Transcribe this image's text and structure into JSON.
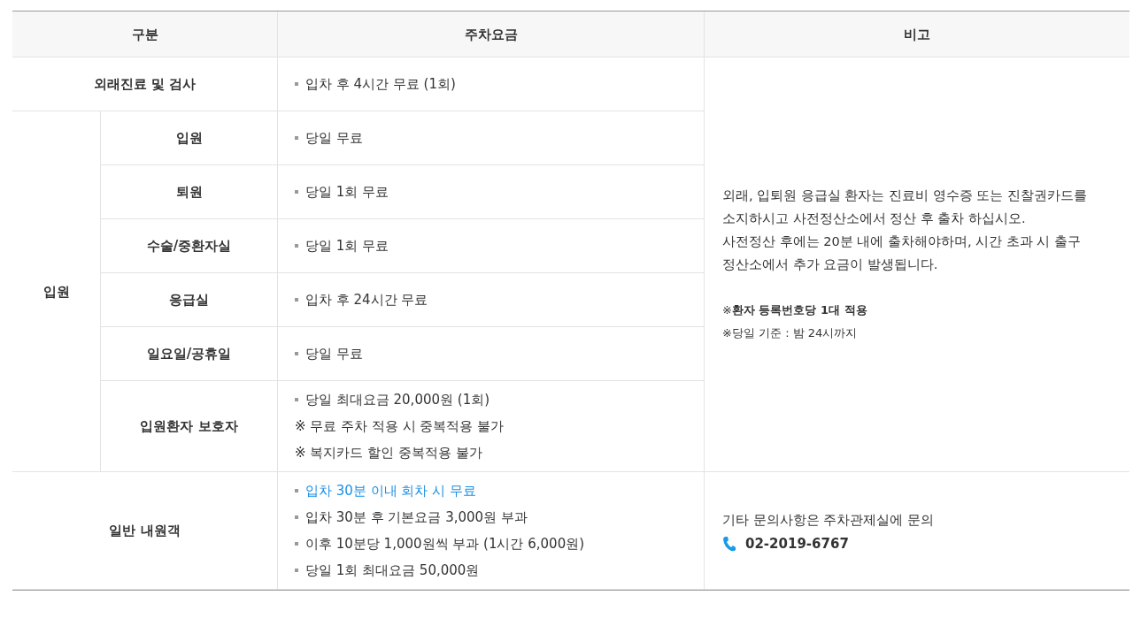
{
  "table": {
    "columns": [
      "구분",
      "주차요금",
      "비고"
    ],
    "sections": [
      {
        "label": "외래진료 및 검사",
        "remark": {
          "paragraphs": [
            "외래, 입퇴원 응급실 환자는 진료비 영수증 또는 진찰권카드를 소지하시고 사전정산소에서 정산 후 출차 하십시오.",
            "사전정산 후에는 20분 내에 출차해야하며, 시간 초과 시 출구 정산소에서 추가 요금이 발생됩니다."
          ],
          "notes": [
            "※**환자 등록번호당 1대 적용**",
            "※당일 기준 : 밤 24시까지"
          ]
        },
        "rows": [
          {
            "fees": [
              {
                "kind": "bullet",
                "text": "입차 후 4시간 무료 (1회)",
                "highlight": false
              }
            ]
          }
        ]
      },
      {
        "label": "입원",
        "rows": [
          {
            "label": "입원",
            "fees": [
              {
                "kind": "bullet",
                "text": "당일 무료",
                "highlight": false
              }
            ]
          },
          {
            "label": "퇴원",
            "fees": [
              {
                "kind": "bullet",
                "text": "당일 1회 무료",
                "highlight": false
              }
            ]
          },
          {
            "label": "수술/중환자실",
            "fees": [
              {
                "kind": "bullet",
                "text": "당일 1회 무료",
                "highlight": false
              }
            ]
          },
          {
            "label": "응급실",
            "fees": [
              {
                "kind": "bullet",
                "text": "입차 후 24시간 무료",
                "highlight": false
              }
            ]
          },
          {
            "label": "일요일/공휴일",
            "fees": [
              {
                "kind": "bullet",
                "text": "당일 무료",
                "highlight": false
              }
            ]
          },
          {
            "label": "입원환자 보호자",
            "fees": [
              {
                "kind": "bullet",
                "text": "당일 최대요금 20,000원 (1회)",
                "highlight": false
              },
              {
                "kind": "note",
                "text": "※ 무료 주차 적용 시 중복적용 불가",
                "highlight": false
              },
              {
                "kind": "note",
                "text": "※ 복지카드 할인 중복적용 불가",
                "highlight": false
              }
            ]
          }
        ]
      },
      {
        "label": "일반 내원객",
        "remark": {
          "paragraphs": [
            "기타 문의사항은 주차관제실에 문의"
          ],
          "phone": "02-2019-6767"
        },
        "rows": [
          {
            "fees": [
              {
                "kind": "bullet",
                "text": "입차 30분 이내 회차 시 무료",
                "highlight": true
              },
              {
                "kind": "bullet",
                "text": "입차 30분 후 기본요금 3,000원 부과",
                "highlight": false
              },
              {
                "kind": "bullet",
                "text": "이후 10분당 1,000원씩 부과 (1시간 6,000원)",
                "highlight": false
              },
              {
                "kind": "bullet",
                "text": "당일 1회 최대요금 50,000원",
                "highlight": false
              }
            ]
          }
        ]
      }
    ]
  }
}
